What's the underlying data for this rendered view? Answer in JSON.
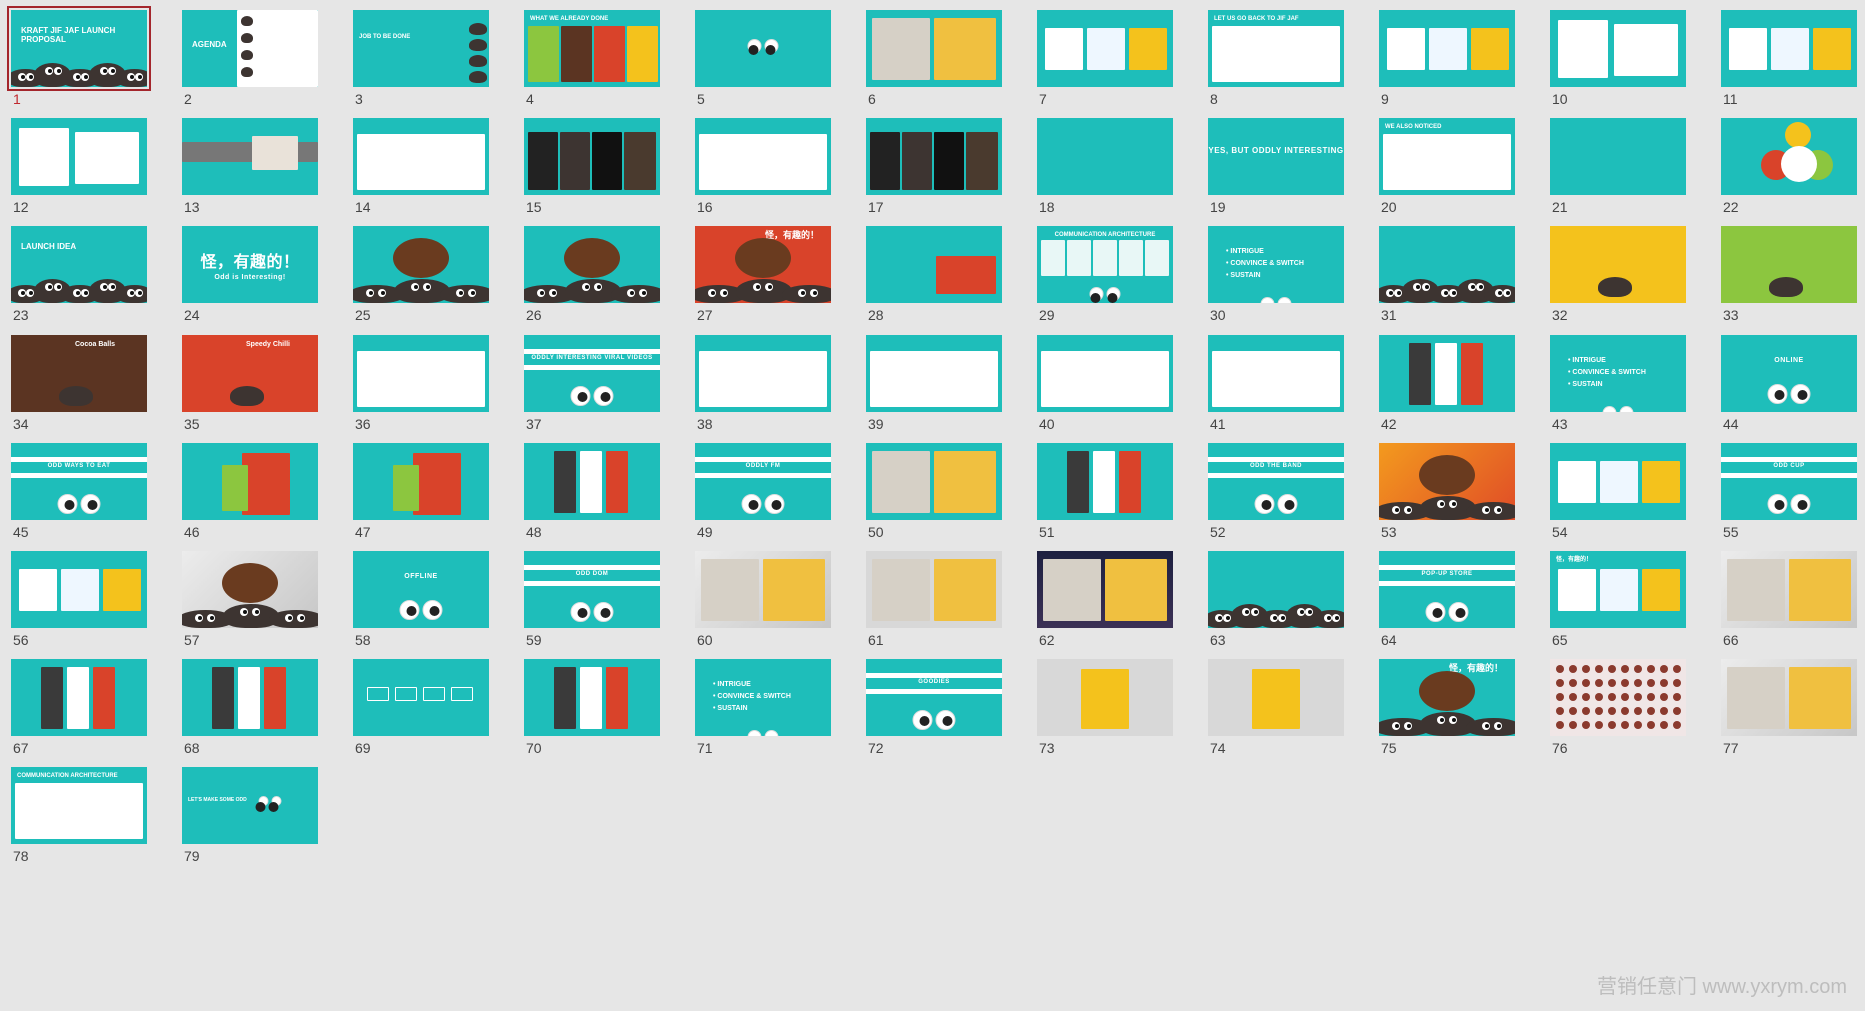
{
  "colors": {
    "teal": "#1ebeba",
    "selection": "#a4262c",
    "number": "#444444",
    "active_number": "#c0282e",
    "background": "#e6e6e6"
  },
  "watermark": "营销任意门 www.yxrym.com",
  "slides": [
    {
      "n": "1",
      "style": "teal",
      "title": "KRAFT JIF JAF LAUNCH PROPOSAL",
      "kind": "chars",
      "selected": true
    },
    {
      "n": "2",
      "style": "teal",
      "title": "AGENDA",
      "kind": "agenda"
    },
    {
      "n": "3",
      "style": "teal",
      "title": "JOB TO BE DONE",
      "kind": "textchars"
    },
    {
      "n": "4",
      "style": "teal",
      "title": "WHAT WE ALREADY DONE",
      "kind": "boxes"
    },
    {
      "n": "5",
      "style": "teal",
      "title": "",
      "kind": "smalleyes"
    },
    {
      "n": "6",
      "style": "teal",
      "title": "",
      "kind": "photo"
    },
    {
      "n": "7",
      "style": "teal",
      "title": "",
      "kind": "cards"
    },
    {
      "n": "8",
      "style": "teal",
      "title": "LET US GO BACK TO JIF JAF",
      "kind": "whitecard"
    },
    {
      "n": "9",
      "style": "teal",
      "title": "",
      "kind": "cards"
    },
    {
      "n": "10",
      "style": "teal",
      "title": "",
      "kind": "cards2"
    },
    {
      "n": "11",
      "style": "teal",
      "title": "",
      "kind": "cards"
    },
    {
      "n": "12",
      "style": "teal",
      "title": "",
      "kind": "cards2"
    },
    {
      "n": "13",
      "style": "teal",
      "title": "",
      "kind": "grayband"
    },
    {
      "n": "14",
      "style": "teal",
      "title": "",
      "kind": "whitecard"
    },
    {
      "n": "15",
      "style": "teal",
      "title": "",
      "kind": "darkcards"
    },
    {
      "n": "16",
      "style": "teal",
      "title": "",
      "kind": "whitecard"
    },
    {
      "n": "17",
      "style": "teal",
      "title": "",
      "kind": "darkcards"
    },
    {
      "n": "18",
      "style": "teal",
      "title": "",
      "kind": "plain"
    },
    {
      "n": "19",
      "style": "teal",
      "title": "YES, BUT ODDLY INTERESTING",
      "kind": "center"
    },
    {
      "n": "20",
      "style": "teal",
      "title": "WE ALSO NOTICED",
      "kind": "whitecard"
    },
    {
      "n": "21",
      "style": "teal",
      "title": "",
      "kind": "plain"
    },
    {
      "n": "22",
      "style": "teal",
      "title": "",
      "kind": "circles"
    },
    {
      "n": "23",
      "style": "teal",
      "title": "LAUNCH IDEA",
      "kind": "chars"
    },
    {
      "n": "24",
      "style": "teal",
      "title": "怪，有趣的！",
      "kind": "slogan",
      "sub": "Odd is Interesting!"
    },
    {
      "n": "25",
      "style": "teal",
      "title": "",
      "kind": "burger"
    },
    {
      "n": "26",
      "style": "teal",
      "title": "",
      "kind": "burger"
    },
    {
      "n": "27",
      "style": "red",
      "title": "怪，有趣的！",
      "kind": "burger"
    },
    {
      "n": "28",
      "style": "teal",
      "title": "",
      "kind": "redcard"
    },
    {
      "n": "29",
      "style": "teal",
      "title": "COMMUNICATION ARCHITECTURE",
      "kind": "smalleyes"
    },
    {
      "n": "30",
      "style": "teal",
      "title": "",
      "kind": "bullets",
      "items": [
        "INTRIGUE",
        "CONVINCE & SWITCH",
        "SUSTAIN"
      ]
    },
    {
      "n": "31",
      "style": "teal",
      "title": "",
      "kind": "chars"
    },
    {
      "n": "32",
      "style": "yellow",
      "title": "",
      "kind": "onechar"
    },
    {
      "n": "33",
      "style": "lime",
      "title": "",
      "kind": "onechar"
    },
    {
      "n": "34",
      "style": "brown",
      "title": "Cocoa Balls",
      "kind": "onechar"
    },
    {
      "n": "35",
      "style": "red",
      "title": "Speedy Chilli",
      "kind": "onechar"
    },
    {
      "n": "36",
      "style": "teal",
      "title": "",
      "kind": "whitecard"
    },
    {
      "n": "37",
      "style": "teal",
      "title": "ODDLY INTERESTING VIRAL VIDEOS",
      "kind": "bandeyes"
    },
    {
      "n": "38",
      "style": "teal",
      "title": "",
      "kind": "whitecard"
    },
    {
      "n": "39",
      "style": "teal",
      "title": "",
      "kind": "whitecard"
    },
    {
      "n": "40",
      "style": "teal",
      "title": "",
      "kind": "whitecard"
    },
    {
      "n": "41",
      "style": "teal",
      "title": "",
      "kind": "whitecard"
    },
    {
      "n": "42",
      "style": "teal",
      "title": "",
      "kind": "phones"
    },
    {
      "n": "43",
      "style": "teal",
      "title": "",
      "kind": "bullets",
      "items": [
        "INTRIGUE",
        "CONVINCE & SWITCH",
        "SUSTAIN"
      ]
    },
    {
      "n": "44",
      "style": "teal",
      "title": "ONLINE",
      "kind": "centereyes"
    },
    {
      "n": "45",
      "style": "teal",
      "title": "ODD WAYS TO EAT",
      "kind": "bandeyes"
    },
    {
      "n": "46",
      "style": "teal",
      "title": "",
      "kind": "pack"
    },
    {
      "n": "47",
      "style": "teal",
      "title": "",
      "kind": "pack"
    },
    {
      "n": "48",
      "style": "teal",
      "title": "",
      "kind": "phones"
    },
    {
      "n": "49",
      "style": "teal",
      "title": "ODDLY FM",
      "kind": "bandeyes"
    },
    {
      "n": "50",
      "style": "teal",
      "title": "",
      "kind": "photo"
    },
    {
      "n": "51",
      "style": "teal",
      "title": "",
      "kind": "phones"
    },
    {
      "n": "52",
      "style": "teal",
      "title": "ODD THE BAND",
      "kind": "bandeyes"
    },
    {
      "n": "53",
      "style": "orange",
      "title": "",
      "kind": "burger"
    },
    {
      "n": "54",
      "style": "teal",
      "title": "",
      "kind": "cards"
    },
    {
      "n": "55",
      "style": "teal",
      "title": "ODD CUP",
      "kind": "bandeyes"
    },
    {
      "n": "56",
      "style": "teal",
      "title": "",
      "kind": "cards"
    },
    {
      "n": "57",
      "style": "photo",
      "title": "",
      "kind": "burger"
    },
    {
      "n": "58",
      "style": "teal",
      "title": "OFFLINE",
      "kind": "centereyes"
    },
    {
      "n": "59",
      "style": "teal",
      "title": "ODD DOM",
      "kind": "bandeyes"
    },
    {
      "n": "60",
      "style": "photo",
      "title": "",
      "kind": "photo"
    },
    {
      "n": "61",
      "style": "grey",
      "title": "",
      "kind": "photo"
    },
    {
      "n": "62",
      "style": "night",
      "title": "",
      "kind": "photo"
    },
    {
      "n": "63",
      "style": "teal",
      "title": "",
      "kind": "chars"
    },
    {
      "n": "64",
      "style": "teal",
      "title": "POP-UP STORE",
      "kind": "bandeyes"
    },
    {
      "n": "65",
      "style": "teal",
      "title": "怪，有趣的！",
      "kind": "cards"
    },
    {
      "n": "66",
      "style": "photo",
      "title": "",
      "kind": "photo"
    },
    {
      "n": "67",
      "style": "teal",
      "title": "",
      "kind": "phones"
    },
    {
      "n": "68",
      "style": "teal",
      "title": "",
      "kind": "phones"
    },
    {
      "n": "69",
      "style": "teal",
      "title": "",
      "kind": "flow"
    },
    {
      "n": "70",
      "style": "teal",
      "title": "",
      "kind": "phones"
    },
    {
      "n": "71",
      "style": "teal",
      "title": "",
      "kind": "bullets",
      "items": [
        "INTRIGUE",
        "CONVINCE & SWITCH",
        "SUSTAIN"
      ]
    },
    {
      "n": "72",
      "style": "teal",
      "title": "GOODIES",
      "kind": "bandeyes"
    },
    {
      "n": "73",
      "style": "grey",
      "title": "",
      "kind": "bag"
    },
    {
      "n": "74",
      "style": "grey",
      "title": "",
      "kind": "bag"
    },
    {
      "n": "75",
      "style": "teal",
      "title": "怪，有趣的！",
      "kind": "burger"
    },
    {
      "n": "76",
      "style": "spots",
      "title": "",
      "kind": "spots"
    },
    {
      "n": "77",
      "style": "photo",
      "title": "",
      "kind": "photo"
    },
    {
      "n": "78",
      "style": "teal",
      "title": "COMMUNICATION ARCHITECTURE",
      "kind": "whitecard"
    },
    {
      "n": "79",
      "style": "teal",
      "title": "LET'S MAKE SOME ODD",
      "kind": "leftlogo"
    }
  ]
}
